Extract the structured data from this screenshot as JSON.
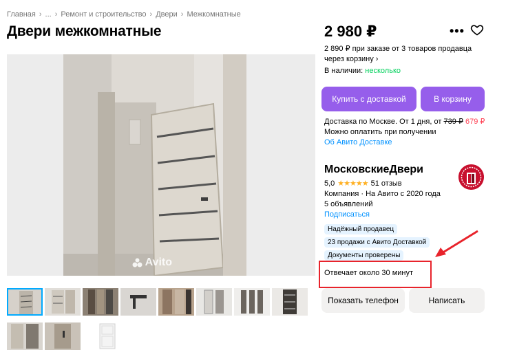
{
  "breadcrumb": {
    "items": [
      "Главная",
      "...",
      "Ремонт и строительство",
      "Двери",
      "Межкомнатные"
    ],
    "separator": "›"
  },
  "title": "Двери межкомнатные",
  "photo": {
    "watermark": "Avito"
  },
  "price": {
    "main": "2 980 ₽",
    "bulk_note": "2 890 ₽ при заказе от 3 товаров продавца через корзину ›",
    "stock_label": "В наличии:",
    "stock_value": "несколько"
  },
  "buttons": {
    "buy_delivery": "Купить с доставкой",
    "to_cart": "В корзину",
    "show_phone": "Показать телефон",
    "write": "Написать"
  },
  "delivery": {
    "prefix": "Доставка по Москве. От 1 дня, от",
    "old_price": "739 ₽",
    "new_price": "679 ₽",
    "pay_note": "Можно оплатить при получении",
    "link": "Об Авито Доставке"
  },
  "seller": {
    "name": "МосковскиеДвери",
    "rating": "5,0",
    "stars": "★★★★★",
    "reviews": "51 отзыв",
    "type_line": "Компания · На Авито с 2020 года",
    "ads": "5 объявлений",
    "subscribe": "Подписаться",
    "badges": [
      "Надёжный продавец",
      "23 продажи с Авито Доставкой",
      "Документы проверены"
    ],
    "response": "Отвечает около 30 минут"
  },
  "colors": {
    "accent": "#965eeb",
    "stock": "#02d15c",
    "link": "#0091ff",
    "discount": "#ff4053",
    "annotation": "#e8232b",
    "badge_bg": "#e5f3ff"
  }
}
